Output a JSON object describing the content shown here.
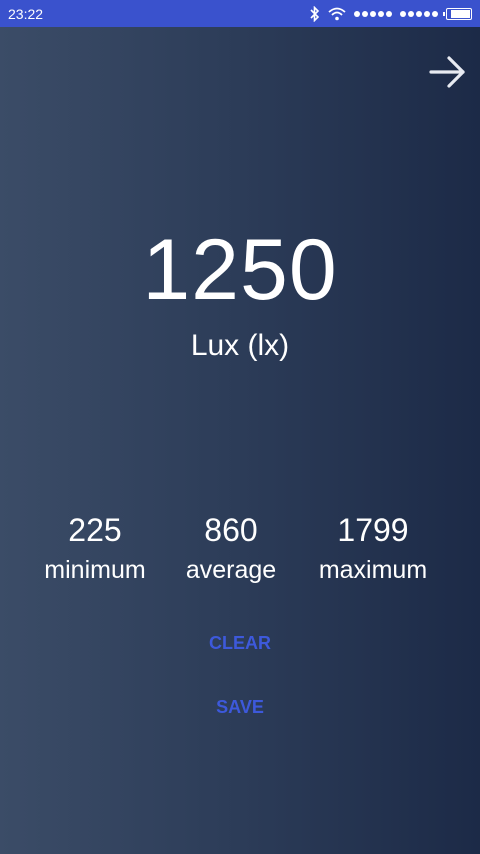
{
  "status_bar": {
    "time": "23:22",
    "bluetooth_icon": "bluetooth-icon",
    "wifi_icon": "wifi-icon",
    "battery_icon": "battery-icon",
    "battery_level": 0.9
  },
  "nav": {
    "next_icon": "arrow-right-icon"
  },
  "reading": {
    "value": "1250",
    "unit": "Lux (lx)"
  },
  "stats": {
    "min_value": "225",
    "min_label": "minimum",
    "avg_value": "860",
    "avg_label": "average",
    "max_value": "1799",
    "max_label": "maximum"
  },
  "actions": {
    "clear_label": "CLEAR",
    "save_label": "SAVE",
    "accent_color": "#3d59db"
  },
  "colors": {
    "status_bar_bg": "#3a52cd",
    "background_left": "#3b4c67",
    "background_right": "#1c2a47"
  }
}
